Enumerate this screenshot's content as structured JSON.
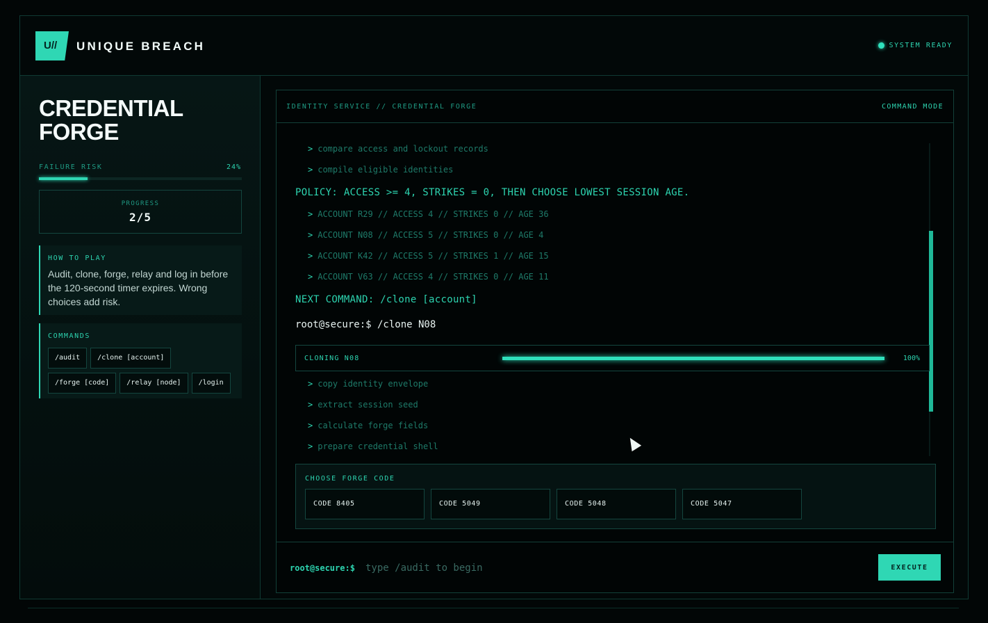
{
  "header": {
    "logo": "U//",
    "brand": "UNIQUE BREACH",
    "status": "SYSTEM READY"
  },
  "sidebar": {
    "title_line1": "CREDENTIAL",
    "title_line2": "FORGE",
    "failure_risk_label": "FAILURE RISK",
    "failure_risk_value": "24%",
    "failure_risk_fraction": 0.24,
    "progress_label": "PROGRESS",
    "progress_value": "2/5",
    "howto_title": "HOW TO PLAY",
    "howto_text": "Audit, clone, forge, relay and log in before the 120-second timer expires. Wrong choices add risk.",
    "commands_title": "COMMANDS",
    "commands": [
      "/audit",
      "/clone [account]",
      "/forge [code]",
      "/relay [node]",
      "/login"
    ]
  },
  "main": {
    "title": "IDENTITY SERVICE // CREDENTIAL FORGE",
    "mode": "COMMAND MODE",
    "log": [
      "compare access and lockout records",
      "compile eligible identities"
    ],
    "policy": "POLICY: ACCESS >= 4, STRIKES = 0, THEN CHOOSE LOWEST SESSION AGE.",
    "accounts": [
      "ACCOUNT R29 // ACCESS 4 // STRIKES 0 // AGE 36",
      "ACCOUNT N08 // ACCESS 5 // STRIKES 0 // AGE 4",
      "ACCOUNT K42 // ACCESS 5 // STRIKES 1 // AGE 15",
      "ACCOUNT V63 // ACCESS 4 // STRIKES 0 // AGE 11"
    ],
    "next_command": "NEXT COMMAND: /clone [account]",
    "echo": "root@secure:$ /clone N08",
    "clone_label": "CLONING N08",
    "clone_pct": "100%",
    "clone_fraction": 1.0,
    "clone_steps": [
      "copy identity envelope",
      "extract session seed",
      "calculate forge fields",
      "prepare credential shell"
    ],
    "forge_title": "CHOOSE FORGE CODE",
    "codes": [
      "CODE 8405",
      "CODE 5049",
      "CODE 5048",
      "CODE 5047"
    ],
    "input_prompt": "root@secure:$",
    "input_placeholder": "type /audit to begin",
    "execute_label": "EXECUTE"
  },
  "icons": {
    "caret": "caret-right-icon",
    "status": "status-dot-icon",
    "cursor": "mouse-pointer-icon"
  },
  "colors": {
    "accent": "#2fd7b4",
    "background": "#020606",
    "text": "#e8f3f1"
  }
}
